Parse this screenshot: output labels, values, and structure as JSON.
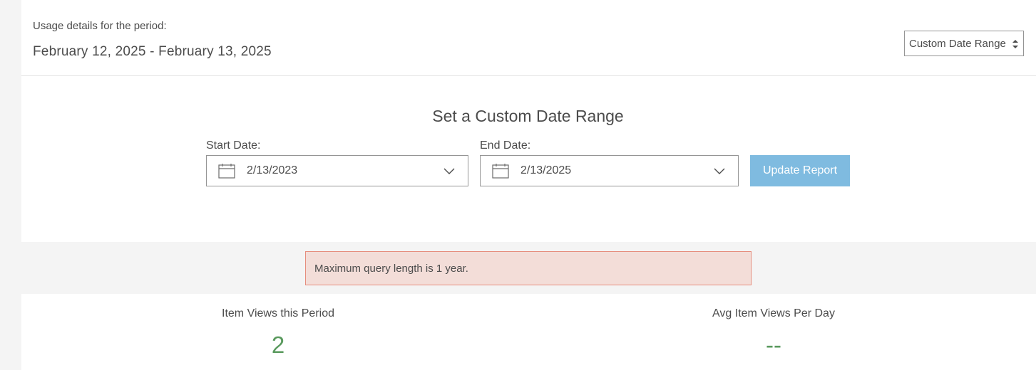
{
  "header": {
    "period_label": "Usage details for the period:",
    "period_range": "February 12, 2025 - February 13, 2025",
    "range_select": {
      "selected": "Custom Date Range",
      "icon": "select-arrows-icon"
    }
  },
  "custom_range": {
    "title": "Set a Custom Date Range",
    "start": {
      "label": "Start Date:",
      "value": "2/13/2023",
      "icons": [
        "calendar-icon",
        "chevron-down-icon"
      ]
    },
    "end": {
      "label": "End Date:",
      "value": "2/13/2025",
      "icons": [
        "calendar-icon",
        "chevron-down-icon"
      ]
    },
    "update_button": "Update Report"
  },
  "alert": {
    "message": "Maximum query length is 1 year."
  },
  "stats": [
    {
      "label": "Item Views this Period",
      "value": "2"
    },
    {
      "label": "Avg Item Views Per Day",
      "value": "--"
    }
  ],
  "colors": {
    "page_bg": "#f4f4f4",
    "panel_bg": "#ffffff",
    "text": "#4c4c4c",
    "button_bg": "#7fbbe0",
    "alert_bg": "#f3ddd8",
    "alert_border": "#e68d7d",
    "stat_value": "#5a9a5e"
  }
}
